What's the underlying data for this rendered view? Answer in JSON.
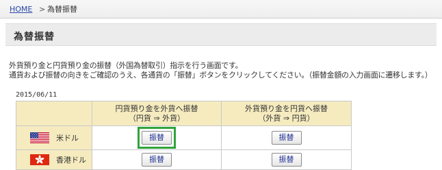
{
  "breadcrumb": {
    "home": "HOME",
    "separator": ">",
    "current": "為替振替"
  },
  "page": {
    "title": "為替振替"
  },
  "description": {
    "line1": "外貨預り金と円貨預り金の振替（外国為替取引）指示を行う画面です。",
    "line2": "通貨および振替の向きをご確認のうえ、各通貨の「振替」ボタンをクリックしてください。（振替金額の入力画面に遷移します。）"
  },
  "date": "2015/06/11",
  "table": {
    "headers": [
      {
        "line1": "円貨預り金を外貨へ振替",
        "line2": "（円貨 ⇒ 外貨）"
      },
      {
        "line1": "外貨預り金を円貨へ振替",
        "line2": "（外貨 ⇒ 円貨）"
      }
    ],
    "rows": [
      {
        "currency": "米ドル",
        "flag": "us-flag-icon",
        "to_foreign_label": "振替",
        "to_yen_label": "振替"
      },
      {
        "currency": "香港ドル",
        "flag": "hk-flag-icon",
        "to_foreign_label": "振替",
        "to_yen_label": "振替"
      }
    ]
  },
  "colors": {
    "header_bg": "#f5ebbf",
    "highlight": "#2fa33a",
    "link": "#2a45a8",
    "button_text": "#1f2f8f"
  }
}
